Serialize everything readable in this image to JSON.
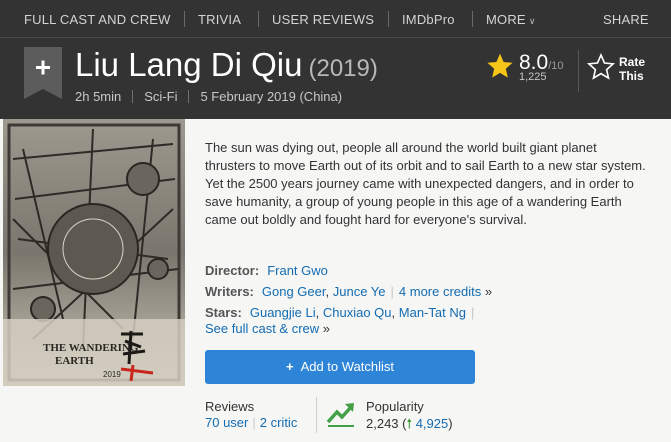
{
  "subnav": {
    "full_cast": "FULL CAST AND CREW",
    "trivia": "TRIVIA",
    "user_reviews": "USER REVIEWS",
    "imdbpro": "IMDbPro",
    "more": "MORE",
    "share": "SHARE"
  },
  "title": {
    "name": "Liu Lang Di Qiu",
    "year": "(2019)"
  },
  "meta": {
    "runtime": "2h 5min",
    "genre": "Sci-Fi",
    "release": "5 February 2019 (China)"
  },
  "rating": {
    "value": "8.0",
    "out_of": "/10",
    "count": "1,225",
    "rate_label": "Rate This",
    "star_color": "#f5c518"
  },
  "summary": "The sun was dying out, people all around the world built giant planet thrusters to move Earth out of its orbit and to sail Earth to a new star system. Yet the 2500 years journey came with unexpected dangers, and in order to save humanity, a group of young people in this age of a wandering Earth came out boldly and fought hard for everyone's survival.",
  "credits": {
    "director_label": "Director:",
    "director": "Frant Gwo",
    "writers_label": "Writers:",
    "writer1": "Gong Geer",
    "writer2": "Junce Ye",
    "writers_more": "4 more credits",
    "stars_label": "Stars:",
    "star1": "Guangjie Li",
    "star2": "Chuxiao Qu",
    "star3": "Man-Tat Ng",
    "full_cast_link": "See full cast & crew",
    "raquo": "»"
  },
  "watchlist": {
    "label": "Add to Watchlist"
  },
  "reviews": {
    "label": "Reviews",
    "user": "70 user",
    "critic": "2 critic"
  },
  "popularity": {
    "label": "Popularity",
    "rank": "2,243",
    "delta": "4,925"
  },
  "poster": {
    "title_line1": "THE WANDERING",
    "title_line2": "EARTH",
    "year": "2019"
  }
}
